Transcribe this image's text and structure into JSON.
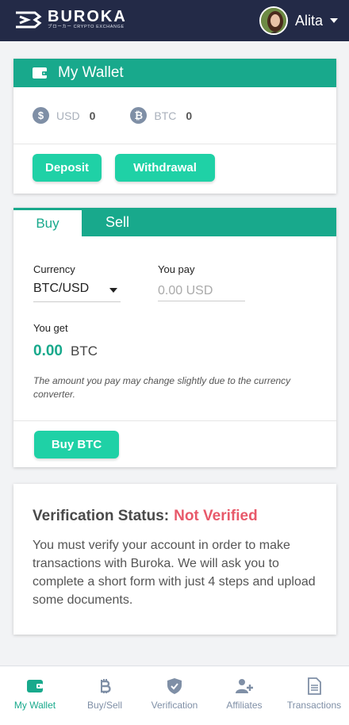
{
  "header": {
    "brand": "BUROKA",
    "brand_sub": "ブローカー CRYPTO EXCHANGE",
    "user_name": "Alita"
  },
  "wallet": {
    "title": "My Wallet",
    "balances": [
      {
        "symbol": "$",
        "currency": "USD",
        "amount": "0",
        "icon": "dollar-coin-icon"
      },
      {
        "symbol": "₿",
        "currency": "BTC",
        "amount": "0",
        "icon": "bitcoin-coin-icon"
      }
    ],
    "deposit_label": "Deposit",
    "withdraw_label": "Withdrawal"
  },
  "trade": {
    "tabs": [
      {
        "label": "Buy",
        "active": true
      },
      {
        "label": "Sell",
        "active": false
      }
    ],
    "currency_label": "Currency",
    "currency_value": "BTC/USD",
    "you_pay_label": "You pay",
    "you_pay_placeholder": "0.00 USD",
    "you_get_label": "You get",
    "you_get_amount": "0.00",
    "you_get_currency": "BTC",
    "note": "The amount you pay may change slightly due to the currency converter.",
    "buy_button": "Buy BTC"
  },
  "verification": {
    "title": "Verification Status:",
    "status": "Not Verified",
    "text": "You must verify your account in order to make transactions with Buroka. We will ask you to complete a short form with just 4 steps and upload some documents."
  },
  "nav": [
    {
      "label": "My Wallet",
      "icon": "wallet-icon",
      "active": true
    },
    {
      "label": "Buy/Sell",
      "icon": "bitcoin-icon",
      "active": false
    },
    {
      "label": "Verification",
      "icon": "shield-check-icon",
      "active": false
    },
    {
      "label": "Affiliates",
      "icon": "add-users-icon",
      "active": false
    },
    {
      "label": "Transactions",
      "icon": "document-icon",
      "active": false
    }
  ],
  "colors": {
    "header_bg": "#232a47",
    "accent": "#18a98c",
    "button": "#1fd1a6",
    "status_red": "#e8596a",
    "muted_icon": "#7f8fa6"
  }
}
